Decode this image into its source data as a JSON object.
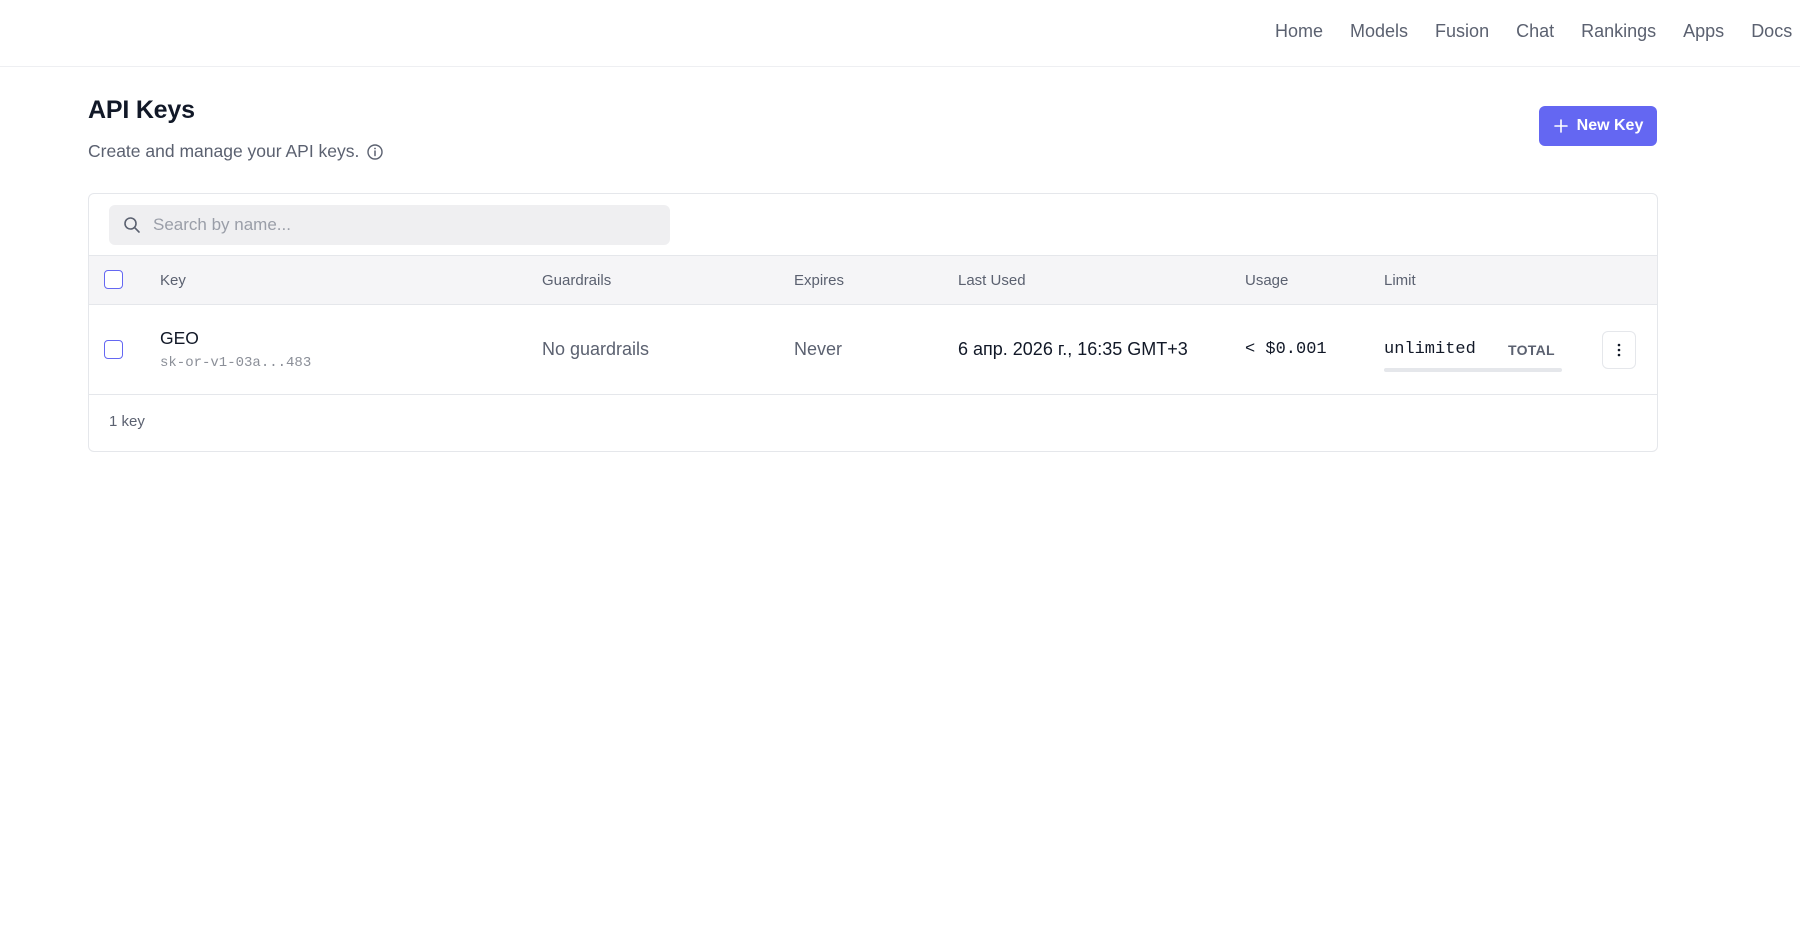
{
  "nav": {
    "items": [
      {
        "label": "Home"
      },
      {
        "label": "Models"
      },
      {
        "label": "Fusion"
      },
      {
        "label": "Chat"
      },
      {
        "label": "Rankings"
      },
      {
        "label": "Apps"
      },
      {
        "label": "Docs"
      }
    ]
  },
  "header": {
    "title": "API Keys",
    "subtitle": "Create and manage your API keys.",
    "info_icon": "info-circle-icon",
    "new_key_button": {
      "label": "New Key",
      "icon": "plus-icon"
    }
  },
  "search": {
    "placeholder": "Search by name...",
    "value": "",
    "icon": "search-icon"
  },
  "table": {
    "columns": [
      "Key",
      "Guardrails",
      "Expires",
      "Last Used",
      "Usage",
      "Limit"
    ],
    "rows": [
      {
        "name": "GEO",
        "key": "sk-or-v1-03a...483",
        "guardrails": "No guardrails",
        "expires": "Never",
        "last_used": "6 апр. 2026 г., 16:35 GMT+3",
        "usage": "< $0.001",
        "limit": "unlimited",
        "limit_type": "TOTAL",
        "limit_used_fraction": 0
      }
    ],
    "footer": "1 key"
  },
  "colors": {
    "accent": "#6467f2",
    "muted_text": "#5b6170",
    "header_bg": "#f5f5f7"
  }
}
